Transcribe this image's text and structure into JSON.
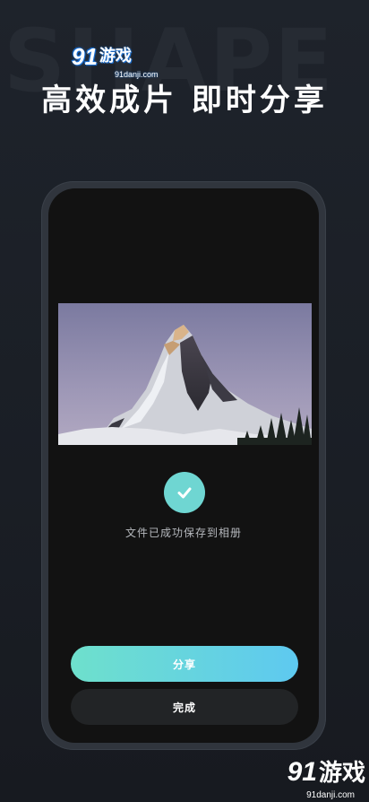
{
  "background": {
    "word": "SHAPE"
  },
  "watermark_top": {
    "logo_num": "91",
    "logo_text": "游戏",
    "site": "91danji.com"
  },
  "headline": "高效成片 即时分享",
  "phone": {
    "check_icon": "check-icon",
    "saved_message": "文件已成功保存到相册",
    "share_button": "分享",
    "done_button": "完成"
  },
  "watermark_bottom": {
    "logo_num": "91",
    "logo_text": "游戏",
    "site": "91danji.com"
  },
  "colors": {
    "accent_start": "#6ee0cc",
    "accent_end": "#5ec9f0",
    "check_circle": "#6fd6d2",
    "screen_bg": "#121212"
  }
}
